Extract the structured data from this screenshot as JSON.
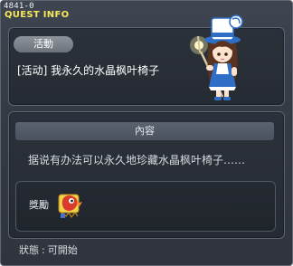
{
  "window": {
    "quest_id": "4841-0",
    "header": "QUEST INFO"
  },
  "quest": {
    "type_label": "活動",
    "name": "[活动] 我永久的水晶枫叶椅子",
    "content_header": "內容",
    "description": "据说有办法可以永久地珍藏水晶枫叶椅子……",
    "reward_label": "獎勵",
    "status_label": "狀態",
    "status_separator": ":",
    "status_value": "可開始"
  },
  "icons": {
    "npc": "npc-girl-with-staff-icon",
    "reward_item": "reward-item-icon"
  },
  "colors": {
    "header_text": "#f7e85a",
    "panel_border": "#5d6673"
  }
}
